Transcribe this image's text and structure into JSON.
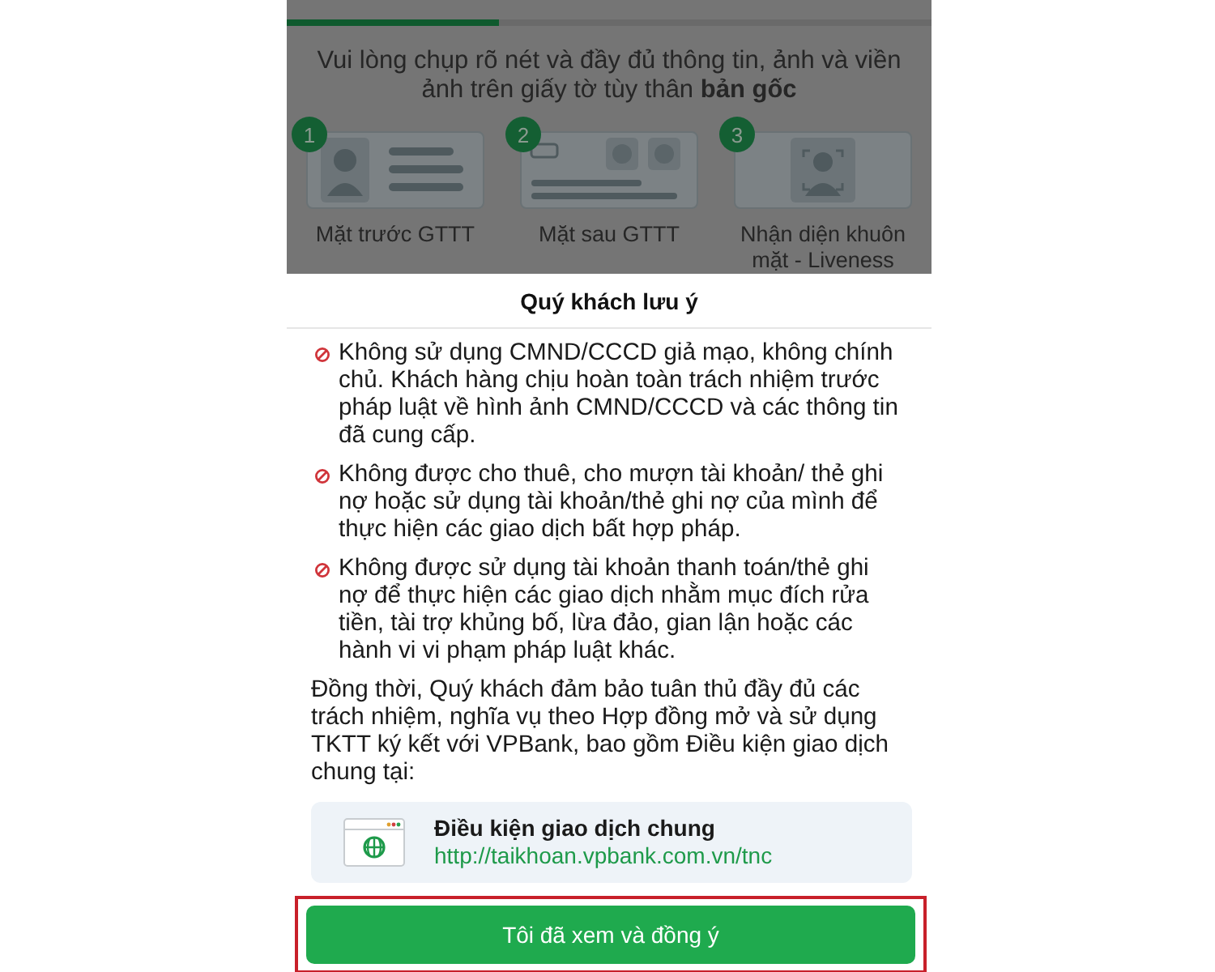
{
  "progress": {
    "level": 0.33
  },
  "instruction": "Vui lòng chụp rõ nét và đầy đủ thông tin, ảnh và viền ảnh trên giấy tờ tùy thân **bản gốc**",
  "steps": [
    {
      "number": "1",
      "label": "Mặt trước GTTT",
      "kind": "front"
    },
    {
      "number": "2",
      "label": "Mặt sau GTTT",
      "kind": "back"
    },
    {
      "number": "3",
      "label": "Nhận diện khuôn mặt - Liveness",
      "kind": "face"
    }
  ],
  "dialog": {
    "title": "Quý khách lưu ý",
    "warnings": [
      "Không sử dụng CMND/CCCD giả mạo, không chính chủ. Khách hàng chịu hoàn toàn trách nhiệm trước pháp luật về hình ảnh CMND/CCCD và các thông tin đã cung cấp.",
      "Không được cho thuê, cho mượn tài khoản/ thẻ ghi nợ hoặc sử dụng tài khoản/thẻ ghi nợ của mình để thực hiện các giao dịch bất hợp pháp.",
      "Không được sử dụng tài khoản thanh toán/thẻ ghi nợ để thực hiện các giao dịch nhằm mục đích rửa tiền, tài trợ khủng bố, lừa đảo, gian lận hoặc các hành vi vi phạm pháp luật khác."
    ],
    "note": "Đồng thời, Quý khách đảm bảo tuân thủ đầy đủ các trách nhiệm, nghĩa vụ theo Hợp đồng mở và sử dụng TKTT ký kết với VPBank, bao gồm Điều kiện giao dịch chung tại:",
    "link": {
      "title": "Điều kiện giao dịch chung",
      "url": "http://taikhoan.vpbank.com.vn/tnc"
    },
    "button": {
      "label": "Tôi đã xem và đồng ý",
      "highlighted": true
    }
  }
}
